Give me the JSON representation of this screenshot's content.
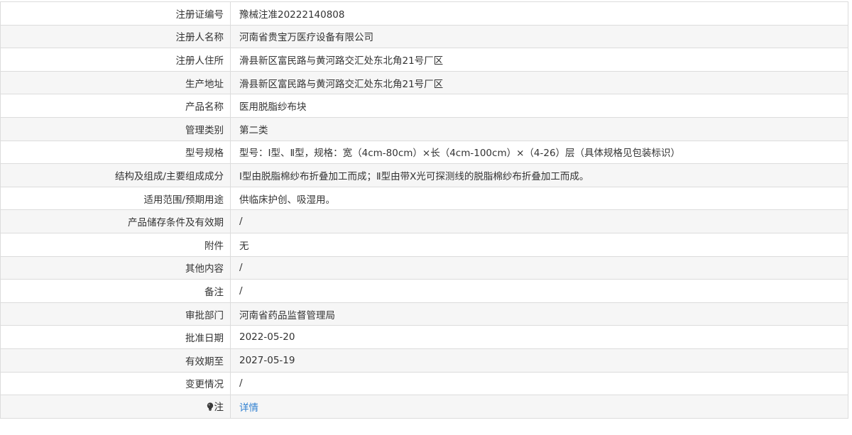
{
  "rows": [
    {
      "label": "注册证编号",
      "value": "豫械注准20222140808"
    },
    {
      "label": "注册人名称",
      "value": "河南省贵宝万医疗设备有限公司"
    },
    {
      "label": "注册人住所",
      "value": "滑县新区富民路与黄河路交汇处东北角21号厂区"
    },
    {
      "label": "生产地址",
      "value": "滑县新区富民路与黄河路交汇处东北角21号厂区"
    },
    {
      "label": "产品名称",
      "value": "医用脱脂纱布块"
    },
    {
      "label": "管理类别",
      "value": "第二类"
    },
    {
      "label": "型号规格",
      "value": "型号：Ⅰ型、Ⅱ型，规格：宽（4cm-80cm）×长（4cm-100cm）×（4-26）层（具体规格见包装标识）"
    },
    {
      "label": "结构及组成/主要组成成分",
      "value": "Ⅰ型由脱脂棉纱布折叠加工而成；Ⅱ型由带X光可探测线的脱脂棉纱布折叠加工而成。"
    },
    {
      "label": "适用范围/预期用途",
      "value": "供临床护创、吸湿用。"
    },
    {
      "label": "产品储存条件及有效期",
      "value": "/"
    },
    {
      "label": "附件",
      "value": "无"
    },
    {
      "label": "其他内容",
      "value": "/"
    },
    {
      "label": "备注",
      "value": "/"
    },
    {
      "label": "审批部门",
      "value": "河南省药品监督管理局"
    },
    {
      "label": "批准日期",
      "value": "2022-05-20"
    },
    {
      "label": "有效期至",
      "value": "2027-05-19"
    },
    {
      "label": "变更情况",
      "value": "/"
    }
  ],
  "note": {
    "icon": "lightbulb-icon",
    "label": "注",
    "link_text": "详情"
  },
  "colors": {
    "border": "#dcdcdc",
    "stripe": "#f6f6f6",
    "text": "#333333",
    "link": "#2f7fd0"
  }
}
